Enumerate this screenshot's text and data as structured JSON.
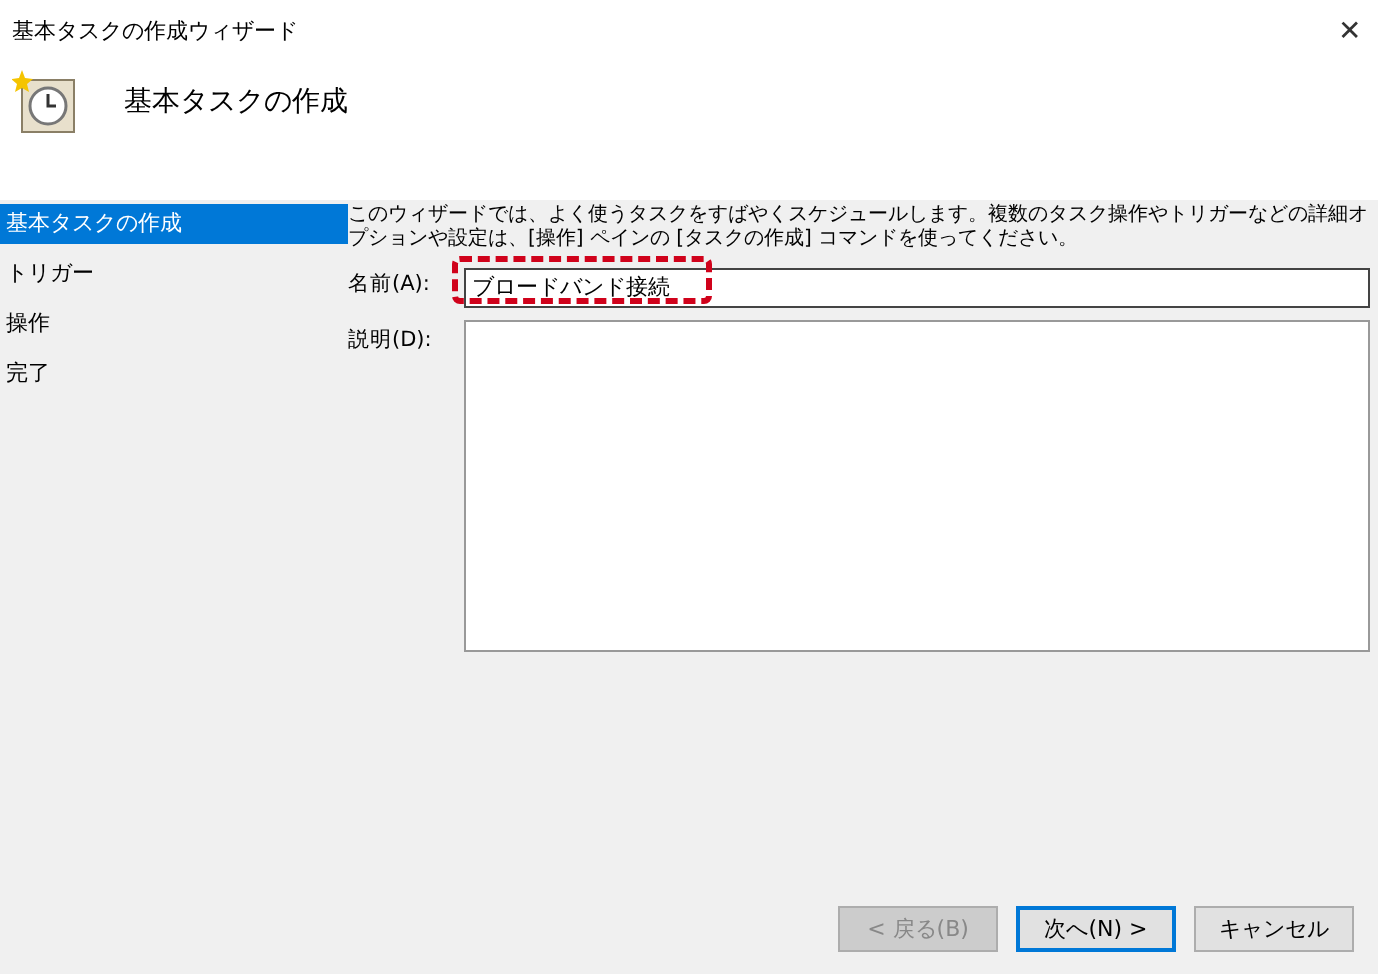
{
  "window": {
    "title": "基本タスクの作成ウィザード",
    "close": "✕"
  },
  "header": {
    "title": "基本タスクの作成"
  },
  "sidebar": {
    "items": [
      {
        "label": "基本タスクの作成",
        "selected": true
      },
      {
        "label": "トリガー",
        "selected": false
      },
      {
        "label": "操作",
        "selected": false
      },
      {
        "label": "完了",
        "selected": false
      }
    ]
  },
  "intro": "このウィザードでは、よく使うタスクをすばやくスケジュールします。複数のタスク操作やトリガーなどの詳細オプションや設定は、[操作] ペインの [タスクの作成] コマンドを使ってください。",
  "form": {
    "name_label": "名前(A):",
    "name_value": "ブロードバンド接続",
    "name_highlighted": true,
    "description_label": "説明(D):"
  },
  "buttons": [
    {
      "label": "< 戻る(B)",
      "disabled": true,
      "default": false
    },
    {
      "label": "次へ(N) >",
      "disabled": false,
      "default": true
    },
    {
      "label": "キャンセル",
      "disabled": false,
      "default": false
    }
  ]
}
